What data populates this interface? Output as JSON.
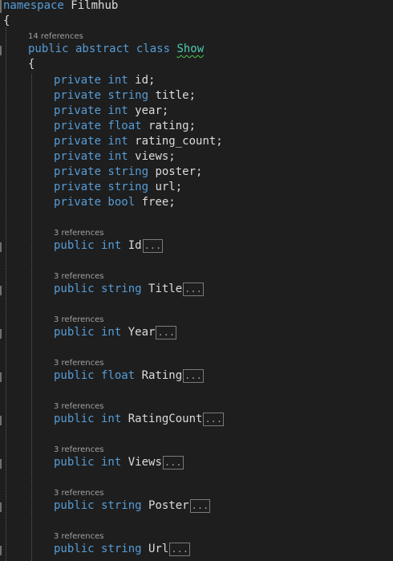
{
  "code": {
    "namespace_keyword": "namespace",
    "namespace_name": "Filmhub",
    "open_brace_ns": "{",
    "class_lens": "14 references",
    "class_modifiers": "public abstract class",
    "class_name": "Show",
    "open_brace_class": "{",
    "fields": [
      {
        "modifiers": "private int",
        "name": "id;"
      },
      {
        "modifiers": "private string",
        "name": "title;"
      },
      {
        "modifiers": "private int",
        "name": "year;"
      },
      {
        "modifiers": "private float",
        "name": "rating;"
      },
      {
        "modifiers": "private int",
        "name": "rating_count;"
      },
      {
        "modifiers": "private int",
        "name": "views;"
      },
      {
        "modifiers": "private string",
        "name": "poster;"
      },
      {
        "modifiers": "private string",
        "name": "url;"
      },
      {
        "modifiers": "private bool",
        "name": "free;"
      }
    ],
    "properties": [
      {
        "lens": "3 references",
        "modifiers": "public int",
        "name": "Id",
        "collapsed": "..."
      },
      {
        "lens": "3 references",
        "modifiers": "public string",
        "name": "Title",
        "collapsed": "..."
      },
      {
        "lens": "3 references",
        "modifiers": "public int",
        "name": "Year",
        "collapsed": "..."
      },
      {
        "lens": "3 references",
        "modifiers": "public float",
        "name": "Rating",
        "collapsed": "..."
      },
      {
        "lens": "3 references",
        "modifiers": "public int",
        "name": "RatingCount",
        "collapsed": "..."
      },
      {
        "lens": "3 references",
        "modifiers": "public int",
        "name": "Views",
        "collapsed": "..."
      },
      {
        "lens": "3 references",
        "modifiers": "public string",
        "name": "Poster",
        "collapsed": "..."
      },
      {
        "lens": "3 references",
        "modifiers": "public string",
        "name": "Url",
        "collapsed": "..."
      }
    ]
  },
  "theme": {
    "background": "#1e1e1e",
    "keyword": "#569cd6",
    "type": "#4ec9b0",
    "text": "#dcdcdc",
    "lens": "#a0a0a0"
  }
}
